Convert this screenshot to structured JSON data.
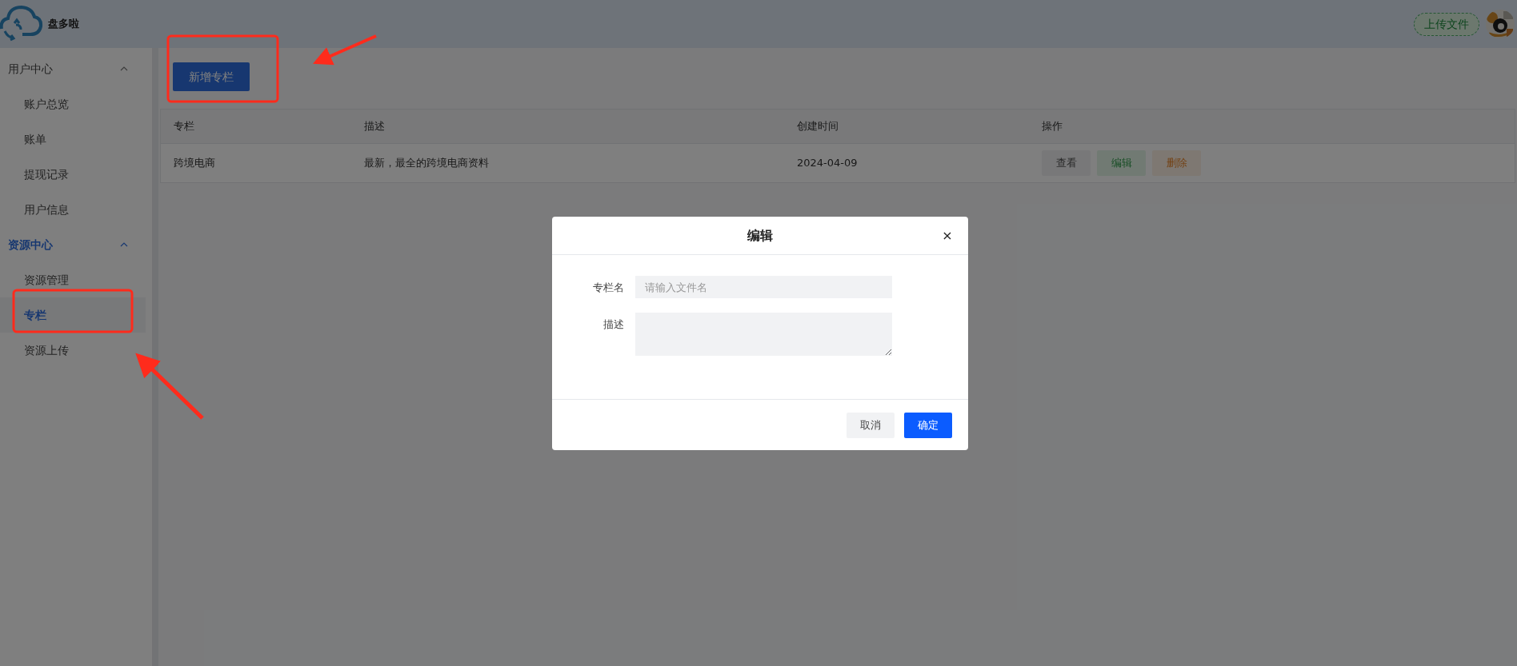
{
  "app": {
    "name": "盘多啦"
  },
  "header": {
    "upload_button": "上传文件"
  },
  "sidebar": {
    "groups": [
      {
        "label": "用户中心",
        "expanded": true,
        "selected": false,
        "items": [
          {
            "label": "账户总览",
            "selected": false
          },
          {
            "label": "账单",
            "selected": false
          },
          {
            "label": "提现记录",
            "selected": false
          },
          {
            "label": "用户信息",
            "selected": false
          }
        ]
      },
      {
        "label": "资源中心",
        "expanded": true,
        "selected": true,
        "items": [
          {
            "label": "资源管理",
            "selected": false
          },
          {
            "label": "专栏",
            "selected": true
          },
          {
            "label": "资源上传",
            "selected": false
          }
        ]
      }
    ]
  },
  "toolbar": {
    "add_button": "新增专栏"
  },
  "table": {
    "columns": [
      "专栏",
      "描述",
      "创建时间",
      "操作"
    ],
    "rows": [
      {
        "cells": [
          "跨境电商",
          "最新，最全的跨境电商资料",
          "2024-04-09"
        ],
        "actions": [
          {
            "label": "查看",
            "kind": "view"
          },
          {
            "label": "编辑",
            "kind": "edit"
          },
          {
            "label": "删除",
            "kind": "delete"
          }
        ]
      }
    ]
  },
  "dialog": {
    "title": "编辑",
    "close": "×",
    "fields": [
      {
        "label": "专栏名",
        "kind": "input",
        "placeholder": "请输入文件名"
      },
      {
        "label": "描述",
        "kind": "textarea"
      }
    ],
    "buttons": [
      {
        "label": "取消",
        "kind": "secondary"
      },
      {
        "label": "确定",
        "kind": "primary"
      }
    ]
  }
}
